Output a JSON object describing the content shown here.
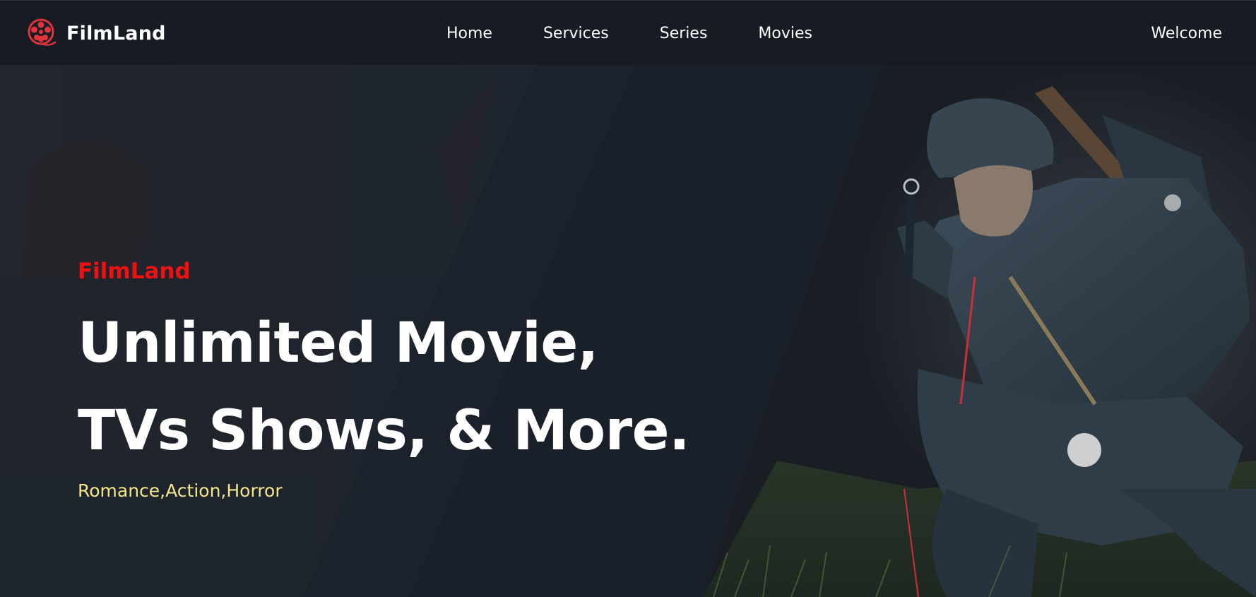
{
  "navbar": {
    "logo_text": "FilmLand",
    "logo_icon": "film-reel-icon",
    "links": [
      "Home",
      "Services",
      "Series",
      "Movies"
    ],
    "right_label": "Welcome"
  },
  "hero": {
    "brand": "FilmLand",
    "headline_line1": "Unlimited Movie,",
    "headline_line2": "TVs Shows, & More.",
    "genres": "Romance,Action,Horror"
  },
  "colors": {
    "background": "#1b212b",
    "navbar": "#171c24",
    "brand_red": "#ee1111",
    "genres_yellow": "#f5e58a",
    "text_white": "#ffffff"
  }
}
